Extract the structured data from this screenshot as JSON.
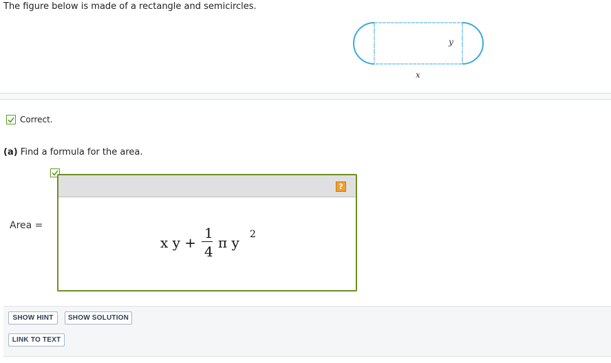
{
  "problem": {
    "text": "The figure below is made of a rectangle and semicircles.",
    "figure": {
      "width_label": "x",
      "height_label": "y",
      "stroke_color": "#3aa8e0"
    }
  },
  "status": {
    "icon": "check-icon",
    "text": "Correct.",
    "color": "#5a9e1e"
  },
  "part_a": {
    "label": "(a)",
    "text": "Find a formula for the area."
  },
  "answer": {
    "label": "Area =",
    "help_label": "?",
    "formula": {
      "term1": "x y +",
      "numerator": "1",
      "denominator": "4",
      "term2": "π y",
      "exponent": "2"
    }
  },
  "actions": {
    "show_hint": "SHOW HINT",
    "show_solution": "SHOW SOLUTION",
    "link_to_text": "LINK TO TEXT"
  }
}
